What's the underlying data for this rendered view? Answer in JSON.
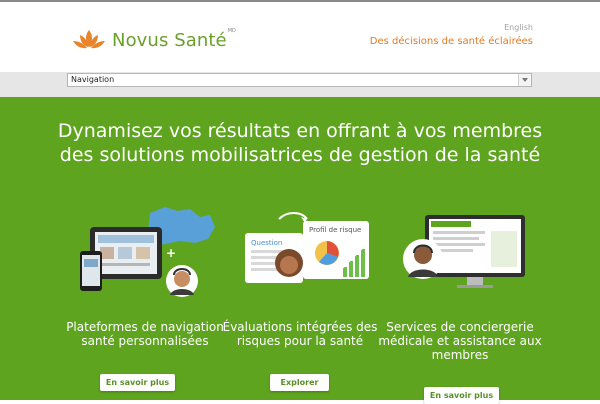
{
  "header": {
    "brand": "Novus Santé",
    "trademark": "MD",
    "language_link": "English",
    "tagline": "Des décisions de santé éclairées"
  },
  "nav": {
    "select_label": "Navigation"
  },
  "hero": {
    "headline": "Dynamisez vos résultats en offrant à vos membres des solutions mobilisatrices de gestion de la santé"
  },
  "features": [
    {
      "title": "Plateformes de navigation santé personnalisées",
      "button": "En savoir plus",
      "icon": "tablet-phone-map-icon"
    },
    {
      "title": "Évaluations intégrées des risques pour la santé",
      "button": "Explorer",
      "icon": "risk-profile-cards-icon",
      "card_labels": [
        "Question",
        "Profil de risque"
      ]
    },
    {
      "title": "Services de conciergerie médicale et assistance aux membres",
      "button": "En savoir plus",
      "icon": "monitor-concierge-icon"
    }
  ],
  "colors": {
    "brand_green": "#6a9f2a",
    "hero_green": "#5ea41f",
    "tagline_orange": "#e07a20"
  }
}
